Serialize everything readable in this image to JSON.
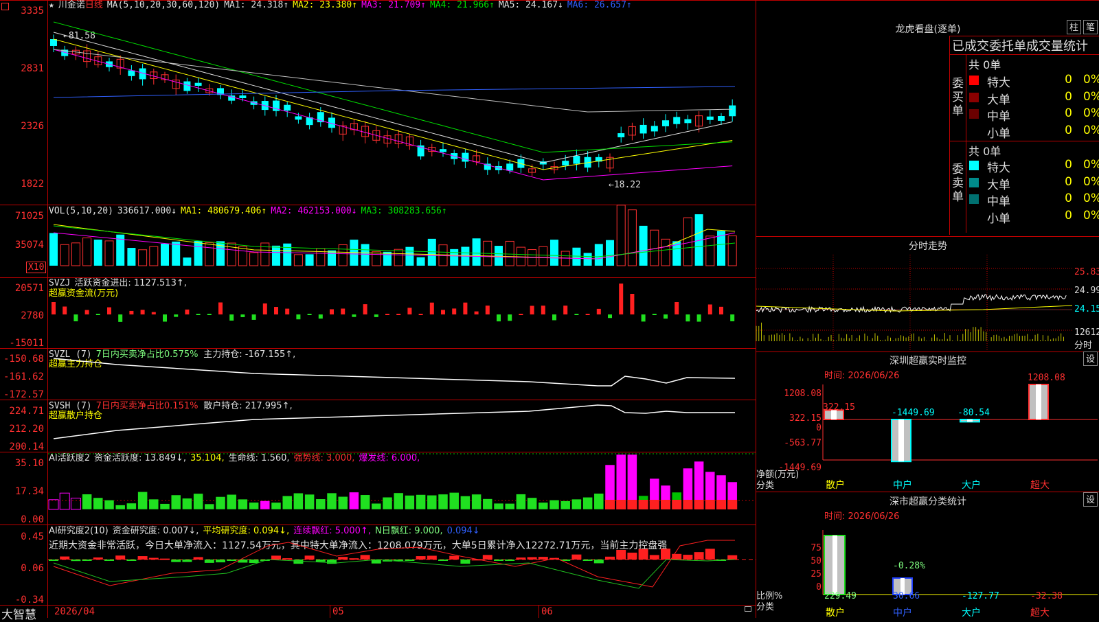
{
  "stock": {
    "icon": "star-icon",
    "name": "川金诺",
    "period": "日线"
  },
  "colors": {
    "up": "#ff3030",
    "down": "#00ffff",
    "grid": "#c00000",
    "ma1": "#e0e0e0",
    "ma2": "#ffff00",
    "ma3": "#ff00ff",
    "ma4": "#00e000",
    "ma5": "#c0c0c0",
    "ma6": "#3060ff"
  },
  "main_legend": {
    "params": "MA(5,10,20,30,60,120)",
    "ma1": "MA1: 24.318↑",
    "ma2": "MA2: 23.380↑",
    "ma3": "MA3: 21.709↑",
    "ma4": "MA4: 21.966↑",
    "ma5": "MA5: 24.167↓",
    "ma6": "MA6: 26.657↑"
  },
  "main_axis": [
    "3335",
    "2831",
    "2326",
    "1822"
  ],
  "price_marks": {
    "high": "81.58",
    "low": "18.22"
  },
  "vol": {
    "params": "VOL(5,10,20)",
    "value": "336617.000↓",
    "ma1": "MA1: 480679.406↑",
    "ma2": "MA2: 462153.000↓",
    "ma3": "MA3: 308283.656↑",
    "axis": [
      "71025",
      "35074"
    ],
    "unit": "X10"
  },
  "svzj": {
    "name": "SVZJ",
    "label": "活跃资金进出: 1127.513↑,",
    "sub": "超赢资金流(万元)",
    "axis": [
      "20571",
      "2780",
      "-15011"
    ]
  },
  "svzl": {
    "name": "SVZL (7)",
    "ratio": "7日内买卖净占比0.575%",
    "label": "主力持仓: -167.155↑,",
    "sub": "超赢主力持仓",
    "axis": [
      "-150.68",
      "-161.62",
      "-172.57"
    ]
  },
  "svsh": {
    "name": "SVSH (7)",
    "ratio": "7日内买卖净占比0.151%",
    "label": "散户持仓: 217.995↑,",
    "sub": "超赢散户持仓",
    "axis": [
      "224.71",
      "212.20",
      "200.14"
    ]
  },
  "ai1": {
    "name": "AI活跃度2",
    "l1": "资金活跃度: 13.849↓,",
    "l2": "35.104,",
    "l3": "生命线: 1.560,",
    "l4": "强势线: 3.000,",
    "l5": "爆发线: 6.000,",
    "axis": [
      "35.10",
      "17.34",
      "0.00"
    ]
  },
  "ai2": {
    "name": "AI研究度2(10)",
    "l1": "资金研究度: 0.007↓,",
    "l2": "平均研究度: 0.094↓,",
    "l3": "连续飘红: 5.000↑,",
    "l4": "N日飘红: 9.000,",
    "l5": "0.094↓",
    "commentary": "近期大资金非常活跃，今日大单净流入：1127.54万元，其中特大单净流入：1208.079万元，大单5日累计净入12272.71万元，当前主力控盘强",
    "axis": [
      "0.45",
      "0.06",
      "-0.34"
    ]
  },
  "bottom": {
    "brand": "大智慧",
    "dates": [
      "2026/04",
      "05",
      "06"
    ]
  },
  "dragon": {
    "title": "龙虎看盘(逐单)",
    "btn1": "柱",
    "btn2": "笔",
    "subtitle": "已成交委托单成交量统计",
    "buy": {
      "side": "委买单",
      "total": "共 0单",
      "rows": [
        {
          "name": "特大",
          "v1": "0",
          "v2": "0%",
          "color": "#ff0000"
        },
        {
          "name": "大单",
          "v1": "0",
          "v2": "0%",
          "color": "#8b0000"
        },
        {
          "name": "中单",
          "v1": "0",
          "v2": "0%",
          "color": "#6b0000"
        },
        {
          "name": "小单",
          "v1": "0",
          "v2": "0%",
          "color": ""
        }
      ]
    },
    "sell": {
      "side": "委卖单",
      "total": "共 0单",
      "rows": [
        {
          "name": "特大",
          "v1": "0",
          "v2": "0%",
          "color": "#00ffff"
        },
        {
          "name": "大单",
          "v1": "0",
          "v2": "0%",
          "color": "#008b8b"
        },
        {
          "name": "中单",
          "v1": "0",
          "v2": "0%",
          "color": "#007070"
        },
        {
          "name": "小单",
          "v1": "0",
          "v2": "0%",
          "color": ""
        }
      ]
    }
  },
  "intraday": {
    "title": "分时走势",
    "axis": [
      "25.83",
      "24.99",
      "24.15",
      "12612"
    ],
    "unit": "分时"
  },
  "sz_monitor": {
    "title": "深圳超赢实时监控",
    "btn": "设",
    "time": "时间: 2026/06/26",
    "axis": [
      "1208.08",
      "322.15",
      "0",
      "-563.77",
      "-1449.69"
    ],
    "ylabel": "净额(万元)",
    "xlabel": "分类",
    "categories": [
      "散户",
      "中户",
      "大户",
      "超大"
    ],
    "values": [
      "322.15",
      "-1449.69",
      "-80.54",
      "1208.08"
    ],
    "nums": [
      322.15,
      -1449.69,
      -80.54,
      1208.08
    ]
  },
  "sz_class": {
    "title": "深市超赢分类统计",
    "btn": "设",
    "time": "时间: 2026/06/26",
    "axis": [
      "75",
      "50",
      "25",
      "0"
    ],
    "ylabel": "比例%",
    "xlabel": "分类",
    "categories": [
      "散户",
      "中户",
      "大户",
      "超大"
    ],
    "values": [
      "229.49",
      "30.66",
      "-127.77",
      "-32.38"
    ],
    "top_label": "-0.28%"
  }
}
